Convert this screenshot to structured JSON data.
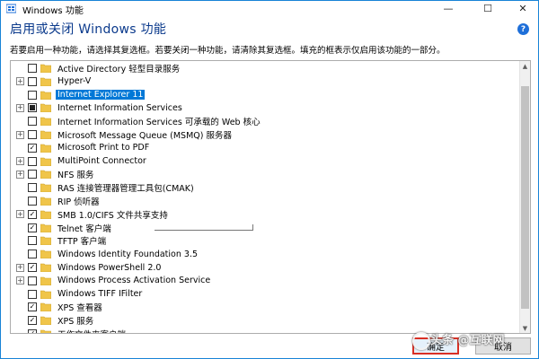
{
  "window": {
    "title": "Windows 功能",
    "controls": {
      "minimize": "—",
      "maximize": "☐",
      "close": "✕"
    }
  },
  "heading": "启用或关闭 Windows 功能",
  "help_icon": "?",
  "description": "若要启用一种功能，请选择其复选框。若要关闭一种功能，请清除其复选框。填充的框表示仅启用该功能的一部分。",
  "features": [
    {
      "label": "Active Directory 轻型目录服务",
      "expandable": false,
      "state": "unchecked",
      "selected": false
    },
    {
      "label": "Hyper-V",
      "expandable": true,
      "state": "unchecked",
      "selected": false
    },
    {
      "label": "Internet Explorer 11",
      "expandable": false,
      "state": "unchecked",
      "selected": true
    },
    {
      "label": "Internet Information Services",
      "expandable": true,
      "state": "partial",
      "selected": false
    },
    {
      "label": "Internet Information Services 可承载的 Web 核心",
      "expandable": false,
      "state": "unchecked",
      "selected": false
    },
    {
      "label": "Microsoft Message Queue (MSMQ) 服务器",
      "expandable": true,
      "state": "unchecked",
      "selected": false
    },
    {
      "label": "Microsoft Print to PDF",
      "expandable": false,
      "state": "checked",
      "selected": false
    },
    {
      "label": "MultiPoint Connector",
      "expandable": true,
      "state": "unchecked",
      "selected": false
    },
    {
      "label": "NFS 服务",
      "expandable": true,
      "state": "unchecked",
      "selected": false
    },
    {
      "label": "RAS 连接管理器管理工具包(CMAK)",
      "expandable": false,
      "state": "unchecked",
      "selected": false
    },
    {
      "label": "RIP 侦听器",
      "expandable": false,
      "state": "unchecked",
      "selected": false
    },
    {
      "label": "SMB 1.0/CIFS 文件共享支持",
      "expandable": true,
      "state": "checked",
      "selected": false
    },
    {
      "label": "Telnet 客户端",
      "expandable": false,
      "state": "checked",
      "selected": false
    },
    {
      "label": "TFTP 客户端",
      "expandable": false,
      "state": "unchecked",
      "selected": false
    },
    {
      "label": "Windows Identity Foundation 3.5",
      "expandable": false,
      "state": "unchecked",
      "selected": false
    },
    {
      "label": "Windows PowerShell 2.0",
      "expandable": true,
      "state": "checked",
      "selected": false
    },
    {
      "label": "Windows Process Activation Service",
      "expandable": true,
      "state": "unchecked",
      "selected": false
    },
    {
      "label": "Windows TIFF IFilter",
      "expandable": false,
      "state": "unchecked",
      "selected": false
    },
    {
      "label": "XPS 查看器",
      "expandable": false,
      "state": "checked",
      "selected": false
    },
    {
      "label": "XPS 服务",
      "expandable": false,
      "state": "checked",
      "selected": false
    },
    {
      "label": "工作文件夹客户端",
      "expandable": false,
      "state": "checked",
      "selected": false
    }
  ],
  "buttons": {
    "ok": "确定",
    "cancel": "取消"
  },
  "watermark": "头条 @互联网",
  "colors": {
    "selection": "#0078d7",
    "heading": "#0b3a8c",
    "folder": "#f0c54a",
    "ok_highlight": "#d93025",
    "window_border": "#1883d7"
  },
  "icons": {
    "app": "windows-features-icon",
    "folder": "folder-icon",
    "expander": "plus-expander-icon",
    "help": "help-icon"
  }
}
